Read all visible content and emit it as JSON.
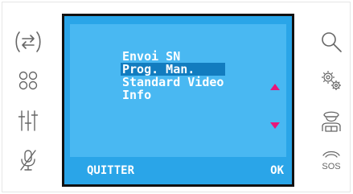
{
  "screen": {
    "menu": [
      {
        "label": "Envoi SN",
        "selected": false
      },
      {
        "label": "Prog. Man.",
        "selected": true
      },
      {
        "label": "Standard Video",
        "selected": false
      },
      {
        "label": "Info",
        "selected": false
      }
    ],
    "softkeys": {
      "left": "QUITTER",
      "right": "OK"
    }
  },
  "buttons": {
    "left": [
      "swap-arrows-icon",
      "four-circles-icon",
      "equalizer-sliders-icon",
      "microphone-muted-icon"
    ],
    "right": [
      "search-icon",
      "gears-icon",
      "concierge-guard-icon",
      "sos-icon"
    ]
  },
  "icons": {
    "sos_text": "SOS"
  },
  "colors": {
    "screen_bg": "#49b8f2",
    "selection": "#127cbf",
    "arrows": "#e8157a",
    "icon_stroke": "#666666"
  }
}
